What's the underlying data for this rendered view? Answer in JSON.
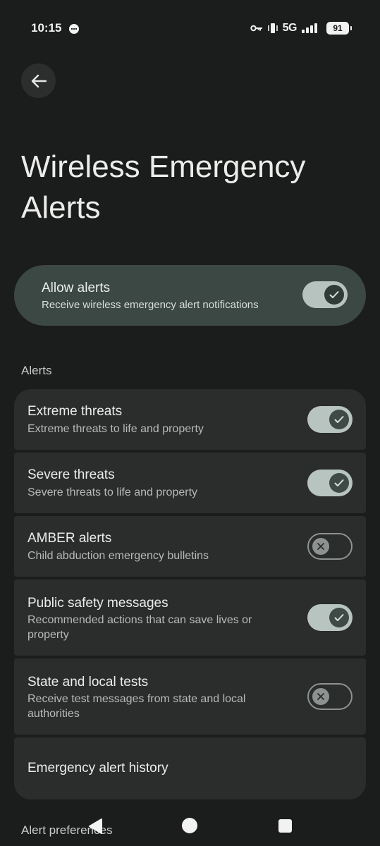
{
  "status_bar": {
    "time": "10:15",
    "network": "5G",
    "battery": "91"
  },
  "title": "Wireless Emergency Alerts",
  "master": {
    "title": "Allow alerts",
    "subtitle": "Receive wireless emergency alert notifications",
    "enabled": true
  },
  "sections": {
    "alerts": "Alerts",
    "preferences": "Alert preferences"
  },
  "items": [
    {
      "title": "Extreme threats",
      "subtitle": "Extreme threats to life and property",
      "enabled": true
    },
    {
      "title": "Severe threats",
      "subtitle": "Severe threats to life and property",
      "enabled": true
    },
    {
      "title": "AMBER alerts",
      "subtitle": "Child abduction emergency bulletins",
      "enabled": false
    },
    {
      "title": "Public safety messages",
      "subtitle": "Recommended actions that can save lives or property",
      "enabled": true
    },
    {
      "title": "State and local tests",
      "subtitle": "Receive test messages from state and local authorities",
      "enabled": false
    },
    {
      "title": "Emergency alert history"
    }
  ],
  "icons": {
    "back": "arrow-left-icon",
    "check": "check-icon",
    "cross": "close-icon",
    "key": "key-icon",
    "vibrate": "vibrate-icon",
    "signal": "signal-icon"
  },
  "colors": {
    "background": "#1b1c1c",
    "card": "#2b2c2c",
    "master_card": "#3c4844",
    "switch_on": "#b8c4bf"
  }
}
